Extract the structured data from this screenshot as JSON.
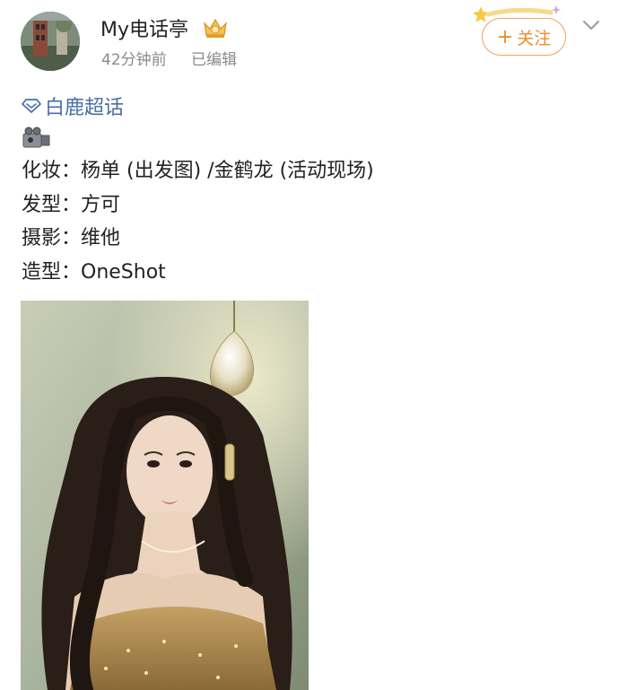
{
  "author": {
    "name": "My电话亭",
    "time": "42分钟前",
    "edited": "已编辑"
  },
  "follow": {
    "label": "关注",
    "plus": "+"
  },
  "topic": {
    "label": "白鹿超话"
  },
  "credits": [
    {
      "label": "化妆：",
      "value": "杨单 (出发图) /金鹤龙 (活动现场)"
    },
    {
      "label": "发型：",
      "value": "方可"
    },
    {
      "label": "摄影：",
      "value": "维他"
    },
    {
      "label": "造型：",
      "value": "OneShot"
    }
  ],
  "colors": {
    "accent_orange": "#f08a2c",
    "topic_blue": "#4a6fa5",
    "meta_gray": "#8a8a8a"
  },
  "icons": {
    "badge": "crown-badge-icon",
    "chevron": "chevron-down-icon",
    "topic": "diamond-topic-icon",
    "camera": "video-camera-emoji"
  }
}
